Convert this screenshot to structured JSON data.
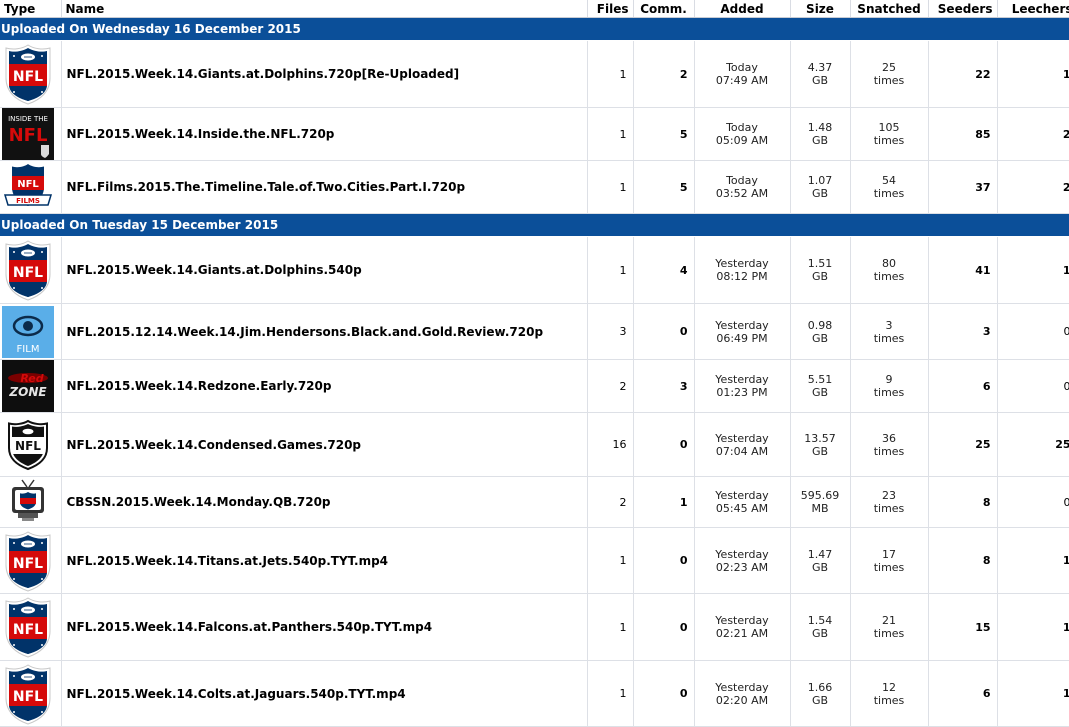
{
  "columns": {
    "type": "Type",
    "name": "Name",
    "files": "Files",
    "comments": "Comm.",
    "added": "Added",
    "size": "Size",
    "snatched": "Snatched",
    "seeders": "Seeders",
    "leechers": "Leechers"
  },
  "groups": [
    {
      "label": "Uploaded On Wednesday 16 December 2015",
      "rows": [
        {
          "icon": "nfl-shield-icon",
          "name": "NFL.2015.Week.14.Giants.at.Dolphins.720p[Re-Uploaded]",
          "files": "1",
          "comments": "2",
          "added_day": "Today",
          "added_time": "07:49 AM",
          "size_value": "4.37",
          "size_unit": "GB",
          "snatched_count": "25",
          "snatched_unit": "times",
          "seeders": "22",
          "leechers": "1"
        },
        {
          "icon": "inside-the-nfl-icon",
          "name": "NFL.2015.Week.14.Inside.the.NFL.720p",
          "files": "1",
          "comments": "5",
          "added_day": "Today",
          "added_time": "05:09 AM",
          "size_value": "1.48",
          "size_unit": "GB",
          "snatched_count": "105",
          "snatched_unit": "times",
          "seeders": "85",
          "leechers": "2"
        },
        {
          "icon": "nfl-films-icon",
          "name": "NFL.Films.2015.The.Timeline.Tale.of.Two.Cities.Part.I.720p",
          "files": "1",
          "comments": "5",
          "added_day": "Today",
          "added_time": "03:52 AM",
          "size_value": "1.07",
          "size_unit": "GB",
          "snatched_count": "54",
          "snatched_unit": "times",
          "seeders": "37",
          "leechers": "2"
        }
      ]
    },
    {
      "label": "Uploaded On Tuesday 15 December 2015",
      "rows": [
        {
          "icon": "nfl-shield-icon",
          "name": "NFL.2015.Week.14.Giants.at.Dolphins.540p",
          "files": "1",
          "comments": "4",
          "added_day": "Yesterday",
          "added_time": "08:12 PM",
          "size_value": "1.51",
          "size_unit": "GB",
          "snatched_count": "80",
          "snatched_unit": "times",
          "seeders": "41",
          "leechers": "1"
        },
        {
          "icon": "film-eye-icon",
          "name": "NFL.2015.12.14.Week.14.Jim.Hendersons.Black.and.Gold.Review.720p",
          "files": "3",
          "comments": "0",
          "added_day": "Yesterday",
          "added_time": "06:49 PM",
          "size_value": "0.98",
          "size_unit": "GB",
          "snatched_count": "3",
          "snatched_unit": "times",
          "seeders": "3",
          "leechers": "0"
        },
        {
          "icon": "redzone-icon",
          "name": "NFL.2015.Week.14.Redzone.Early.720p",
          "files": "2",
          "comments": "3",
          "added_day": "Yesterday",
          "added_time": "01:23 PM",
          "size_value": "5.51",
          "size_unit": "GB",
          "snatched_count": "9",
          "snatched_unit": "times",
          "seeders": "6",
          "leechers": "0"
        },
        {
          "icon": "nfl-shield-bw-icon",
          "name": "NFL.2015.Week.14.Condensed.Games.720p",
          "files": "16",
          "comments": "0",
          "added_day": "Yesterday",
          "added_time": "07:04 AM",
          "size_value": "13.57",
          "size_unit": "GB",
          "snatched_count": "36",
          "snatched_unit": "times",
          "seeders": "25",
          "leechers": "25"
        },
        {
          "icon": "tv-icon",
          "name": "CBSSN.2015.Week.14.Monday.QB.720p",
          "files": "2",
          "comments": "1",
          "added_day": "Yesterday",
          "added_time": "05:45 AM",
          "size_value": "595.69",
          "size_unit": "MB",
          "snatched_count": "23",
          "snatched_unit": "times",
          "seeders": "8",
          "leechers": "0"
        },
        {
          "icon": "nfl-shield-icon",
          "name": "NFL.2015.Week.14.Titans.at.Jets.540p.TYT.mp4",
          "files": "1",
          "comments": "0",
          "added_day": "Yesterday",
          "added_time": "02:23 AM",
          "size_value": "1.47",
          "size_unit": "GB",
          "snatched_count": "17",
          "snatched_unit": "times",
          "seeders": "8",
          "leechers": "1"
        },
        {
          "icon": "nfl-shield-icon",
          "name": "NFL.2015.Week.14.Falcons.at.Panthers.540p.TYT.mp4",
          "files": "1",
          "comments": "0",
          "added_day": "Yesterday",
          "added_time": "02:21 AM",
          "size_value": "1.54",
          "size_unit": "GB",
          "snatched_count": "21",
          "snatched_unit": "times",
          "seeders": "15",
          "leechers": "1"
        },
        {
          "icon": "nfl-shield-icon",
          "name": "NFL.2015.Week.14.Colts.at.Jaguars.540p.TYT.mp4",
          "files": "1",
          "comments": "0",
          "added_day": "Yesterday",
          "added_time": "02:20 AM",
          "size_value": "1.66",
          "size_unit": "GB",
          "snatched_count": "12",
          "snatched_unit": "times",
          "seeders": "6",
          "leechers": "1"
        }
      ]
    }
  ],
  "colors": {
    "group_header_bg": "#0b4f99",
    "nfl_blue": "#013369",
    "nfl_red": "#d50a0a",
    "film_blue": "#5aaee8"
  }
}
